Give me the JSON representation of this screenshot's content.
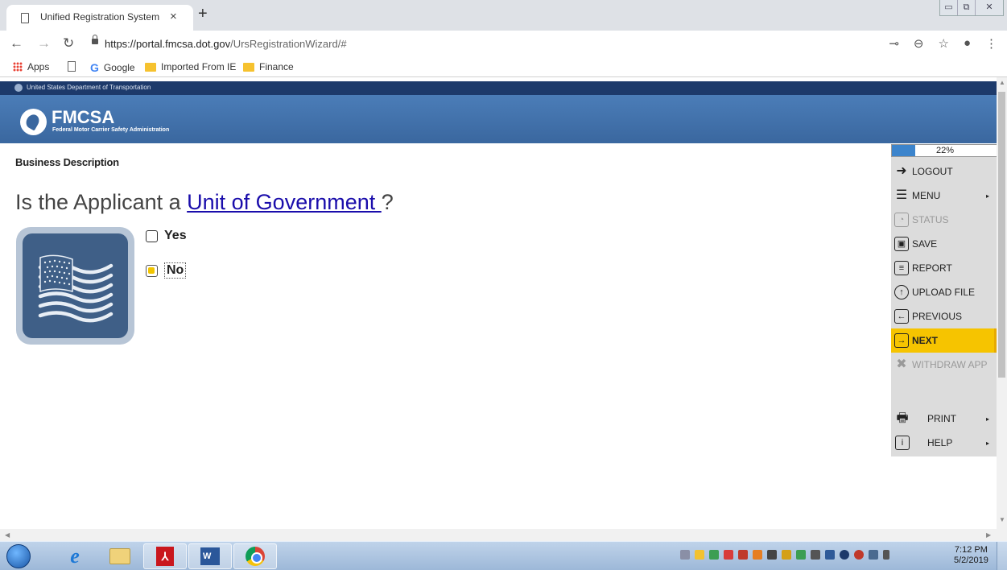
{
  "browser": {
    "tab_title": "Unified Registration System",
    "tab_close": "×",
    "new_tab": "+",
    "url_host": "https://portal.fmcsa.dot.gov",
    "url_path": "/UrsRegistrationWizard/#",
    "window_controls": [
      "▭",
      "⧉",
      "✕"
    ],
    "bookmarks": [
      "Apps",
      "Google",
      "Imported From IE",
      "Finance"
    ]
  },
  "site": {
    "gov_line": "United States Department of Transportation",
    "agency_short": "FMCSA",
    "agency_full": "Federal Motor Carrier Safety Administration"
  },
  "page": {
    "section_title": "Business Description",
    "question_prefix": "Is the Applicant a ",
    "question_link": "Unit of Government ",
    "question_suffix": "?",
    "options": [
      {
        "label": "Yes",
        "checked": false
      },
      {
        "label": "No",
        "checked": true
      }
    ]
  },
  "sidebar": {
    "progress_label": "22%",
    "progress_value": 0.22,
    "items": [
      {
        "label": "LOGOUT",
        "icon": "logout-icon",
        "glyph": "➜",
        "state": "normal"
      },
      {
        "label": "MENU",
        "icon": "menu-icon",
        "glyph": "☰",
        "state": "normal",
        "caret": "▸"
      },
      {
        "label": "STATUS",
        "icon": "status-icon",
        "glyph": "◔",
        "state": "disabled"
      },
      {
        "label": "SAVE",
        "icon": "save-icon",
        "glyph": "▣",
        "state": "normal"
      },
      {
        "label": "REPORT",
        "icon": "report-icon",
        "glyph": "≡",
        "state": "normal"
      },
      {
        "label": "UPLOAD FILE",
        "icon": "upload-icon",
        "glyph": "↑",
        "state": "normal"
      },
      {
        "label": "PREVIOUS",
        "icon": "previous-icon",
        "glyph": "←",
        "state": "normal"
      },
      {
        "label": "NEXT",
        "icon": "next-icon",
        "glyph": "→",
        "state": "active"
      },
      {
        "label": "WITHDRAW APP",
        "icon": "withdraw-icon",
        "glyph": "✖",
        "state": "disabled"
      },
      {
        "label": "PRINT",
        "icon": "printer-icon",
        "glyph": "🖶",
        "state": "normal",
        "caret": "▸"
      },
      {
        "label": "HELP",
        "icon": "info-icon",
        "glyph": "i",
        "state": "normal",
        "caret": "▸"
      }
    ]
  },
  "taskbar": {
    "time": "7:12 PM",
    "date": "5/2/2019"
  },
  "colors": {
    "accent": "#f6c400",
    "header_blue": "#3a679f",
    "gov_strip": "#1d3a6b",
    "link": "#1a0dab"
  }
}
